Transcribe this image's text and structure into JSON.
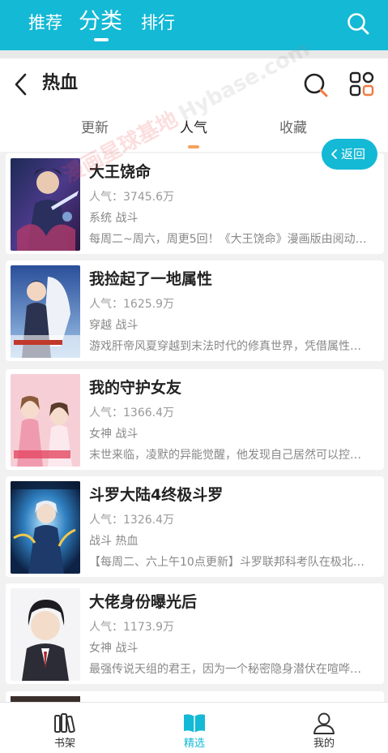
{
  "topnav": {
    "tabs": [
      {
        "label": "推荐"
      },
      {
        "label": "分类"
      },
      {
        "label": "排行"
      }
    ],
    "active_tab": "分类"
  },
  "header": {
    "title": "热血",
    "subtabs": [
      {
        "label": "更新"
      },
      {
        "label": "人气"
      },
      {
        "label": "收藏"
      }
    ],
    "active_subtab": "人气"
  },
  "back_button_label": "返回",
  "watermark": {
    "line1": "漫画星球基地",
    "line2": "Hybase.com"
  },
  "comics": [
    {
      "title": "大王饶命",
      "popularity": "人气：3745.6万",
      "tags": "系统 战斗",
      "desc": "每周二~周六，周更5回！《大王饶命》漫画版由阅动…"
    },
    {
      "title": "我捡起了一地属性",
      "popularity": "人气：1625.9万",
      "tags": "穿越 战斗",
      "desc": "游戏肝帝风夏穿越到末法时代的修真世界，凭借属性…"
    },
    {
      "title": "我的守护女友",
      "popularity": "人气：1366.4万",
      "tags": "女神 战斗",
      "desc": "末世来临，凌默的异能觉醒，他发现自己居然可以控…"
    },
    {
      "title": "斗罗大陆4终极斗罗",
      "popularity": "人气：1326.4万",
      "tags": "战斗 热血",
      "desc": "【每周二、六上午10点更新】斗罗联邦科考队在极北…"
    },
    {
      "title": "大佬身份曝光后",
      "popularity": "人气：1173.9万",
      "tags": "女神 战斗",
      "desc": "最强传说天组的君王，因为一个秘密隐身潜伏在喧哗…"
    }
  ],
  "bottomnav": {
    "items": [
      {
        "label": "书架"
      },
      {
        "label": "精选"
      },
      {
        "label": "我的"
      }
    ],
    "active": "精选"
  },
  "colors": {
    "accent": "#14b9d5",
    "indicator": "#f5a25c"
  }
}
